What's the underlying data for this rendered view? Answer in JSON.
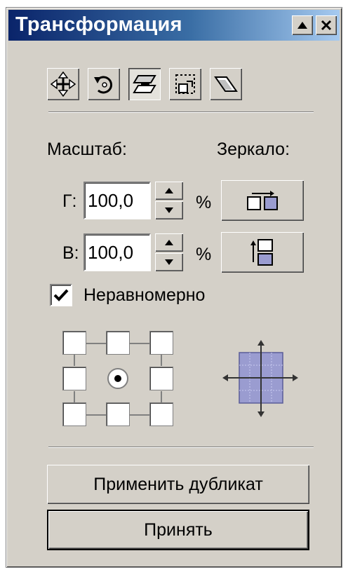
{
  "window": {
    "title": "Трансформация"
  },
  "toolbar": {
    "tools": [
      {
        "name": "position",
        "icon": "move-arrows-icon",
        "pressed": false
      },
      {
        "name": "rotate",
        "icon": "rotate-icon",
        "pressed": false
      },
      {
        "name": "scale-mirror",
        "icon": "scale-mirror-icon",
        "pressed": true
      },
      {
        "name": "size",
        "icon": "size-icon",
        "pressed": false
      },
      {
        "name": "skew",
        "icon": "skew-icon",
        "pressed": false
      }
    ]
  },
  "scale": {
    "label": "Масштаб:",
    "h_label": "Г:",
    "h_value": "100,0",
    "v_label": "В:",
    "v_value": "100,0",
    "unit": "%"
  },
  "mirror": {
    "label": "Зеркало:",
    "h_icon": "mirror-horizontal-icon",
    "v_icon": "mirror-vertical-icon"
  },
  "nonproportional": {
    "label": "Неравномерно",
    "checked": true
  },
  "anchor": {
    "selected": "center"
  },
  "buttons": {
    "apply_duplicate": "Применить дубликат",
    "apply": "Принять"
  },
  "colors": {
    "title_bar_start": "#0a246a",
    "title_bar_end": "#a6caf0",
    "panel": "#d4d0c8",
    "preview_fill": "#9a9cd0"
  }
}
